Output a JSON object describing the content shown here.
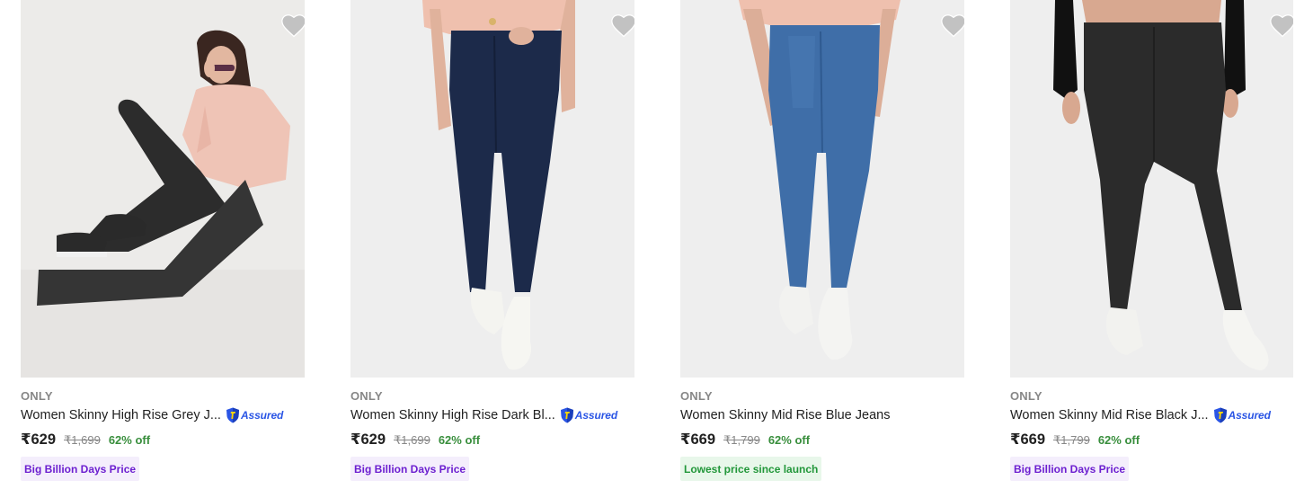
{
  "products": [
    {
      "brand": "ONLY",
      "title": "Women Skinny High Rise Grey J...",
      "assured": true,
      "assured_label": "Assured",
      "price": "₹629",
      "mrp": "₹1,699",
      "discount": "62% off",
      "tag": "Big Billion Days Price",
      "tag_style": "purple"
    },
    {
      "brand": "ONLY",
      "title": "Women Skinny High Rise Dark Bl...",
      "assured": true,
      "assured_label": "Assured",
      "price": "₹629",
      "mrp": "₹1,699",
      "discount": "62% off",
      "tag": "Big Billion Days Price",
      "tag_style": "purple"
    },
    {
      "brand": "ONLY",
      "title": "Women Skinny Mid Rise Blue Jeans",
      "assured": false,
      "assured_label": "",
      "price": "₹669",
      "mrp": "₹1,799",
      "discount": "62% off",
      "tag": "Lowest price since launch",
      "tag_style": "green"
    },
    {
      "brand": "ONLY",
      "title": "Women Skinny Mid Rise Black J...",
      "assured": true,
      "assured_label": "Assured",
      "price": "₹669",
      "mrp": "₹1,799",
      "discount": "62% off",
      "tag": "Big Billion Days Price",
      "tag_style": "purple"
    }
  ],
  "icons": {
    "wishlist": "heart-icon",
    "assured": "shield-icon"
  },
  "colors": {
    "price_text": "#212121",
    "brand_text": "#878787",
    "discount_green": "#388e3c",
    "assured_blue": "#2a55e5",
    "tag_purple_bg": "#f4eefc",
    "tag_purple_text": "#6c1fd0",
    "tag_green_bg": "#e8f7ea",
    "tag_green_text": "#22973a",
    "wishlist_grey": "#c2c2c2"
  }
}
